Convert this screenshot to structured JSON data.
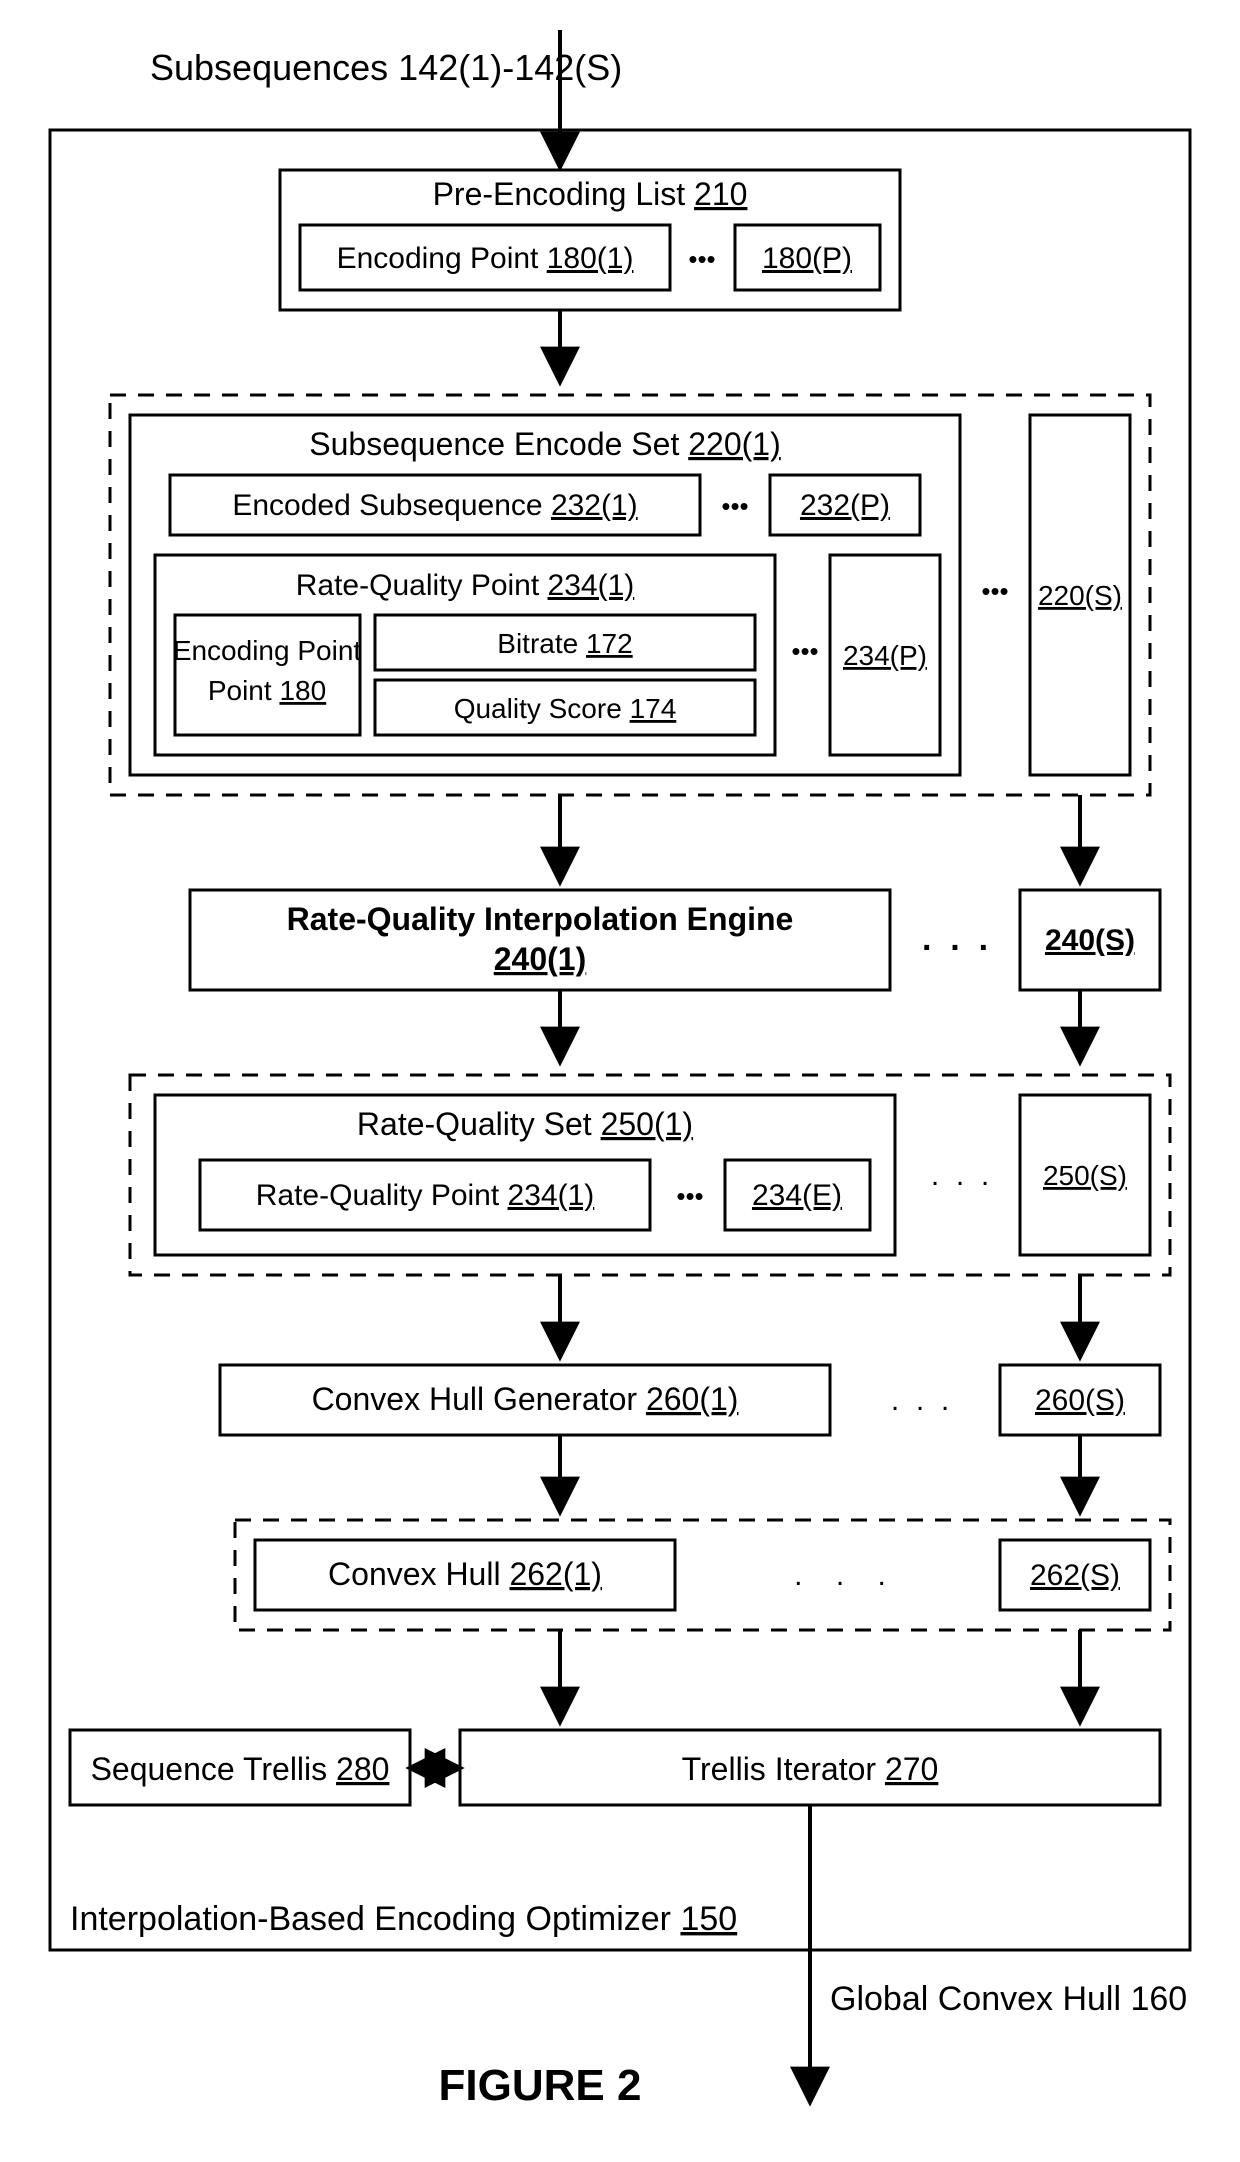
{
  "inputLabel": "Subsequences 142(1)-142(S)",
  "outerLabel": {
    "text": "Interpolation-Based Encoding Optimizer ",
    "ref": "150"
  },
  "outputLabel": "Global Convex Hull 160",
  "figure": "FIGURE 2",
  "preList": {
    "title": "Pre-Encoding List ",
    "ref": "210",
    "encPt1": "Encoding Point ",
    "encPt1Ref": "180(1)",
    "encPtP": "180(P)"
  },
  "subEnc": {
    "title": "Subsequence Encode Set ",
    "ref": "220(1)",
    "encSub1": "Encoded Subsequence ",
    "encSub1Ref": "232(1)",
    "encSubP": "232(P)",
    "rq": {
      "title": "Rate-Quality Point ",
      "ref": "234(1)"
    },
    "encPt": {
      "title": "Encoding Point ",
      "ref": "180"
    },
    "bitrate": {
      "title": "Bitrate ",
      "ref": "172"
    },
    "qscore": {
      "title": "Quality Score ",
      "ref": "174"
    },
    "rqP": "234(P)",
    "right": "220(S)"
  },
  "interp": {
    "title": "Rate-Quality Interpolation Engine",
    "ref": "240(1)",
    "right": "240(S)"
  },
  "rqSet": {
    "title": "Rate-Quality Set ",
    "ref": "250(1)",
    "rq1": "Rate-Quality Point ",
    "rq1Ref": "234(1)",
    "rqE": "234(E)",
    "right": "250(S)"
  },
  "chGen": {
    "title": "Convex Hull Generator ",
    "ref": "260(1)",
    "right": "260(S)"
  },
  "ch": {
    "title": "Convex Hull ",
    "ref": "262(1)",
    "right": "262(S)"
  },
  "trellis": {
    "title": "Trellis Iterator ",
    "ref": "270"
  },
  "seqTrellis": {
    "title": "Sequence Trellis ",
    "ref": "280"
  },
  "dots3": "•••",
  "ell": ". . ."
}
